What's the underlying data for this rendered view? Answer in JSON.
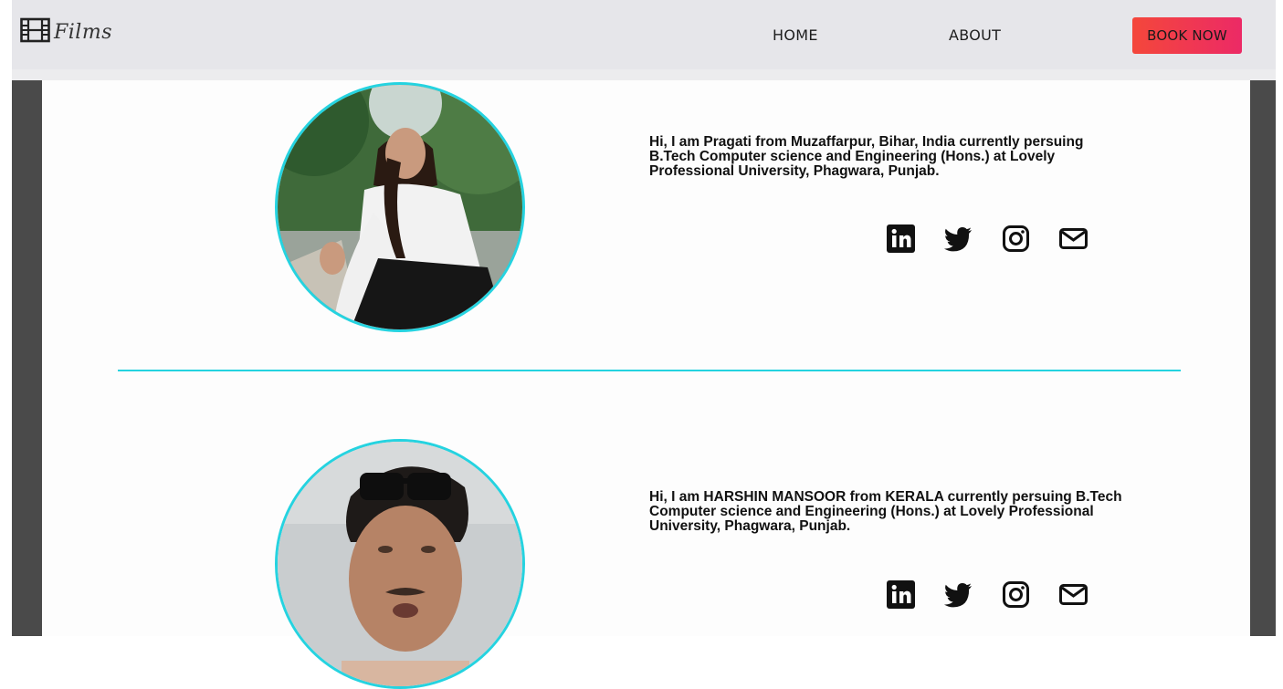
{
  "header": {
    "logo_text": "Films",
    "nav": {
      "home": "HOME",
      "about": "ABOUT"
    },
    "cta": "BOOK NOW"
  },
  "colors": {
    "accent": "#25d3e0",
    "cta_start": "#f4473b",
    "cta_end": "#ec2a66"
  },
  "members": [
    {
      "bio": "Hi, I am Pragati from Muzaffarpur, Bihar, India currently persuing B.Tech Computer science and Engineering (Hons.) at Lovely Professional University, Phagwara, Punjab.",
      "socials": [
        "linkedin-icon",
        "twitter-icon",
        "instagram-icon",
        "mail-icon"
      ]
    },
    {
      "bio": "Hi, I am HARSHIN MANSOOR from KERALA currently persuing B.Tech Computer science and Engineering (Hons.) at Lovely Professional University, Phagwara, Punjab.",
      "socials": [
        "linkedin-icon",
        "twitter-icon",
        "instagram-icon",
        "mail-icon"
      ]
    }
  ]
}
